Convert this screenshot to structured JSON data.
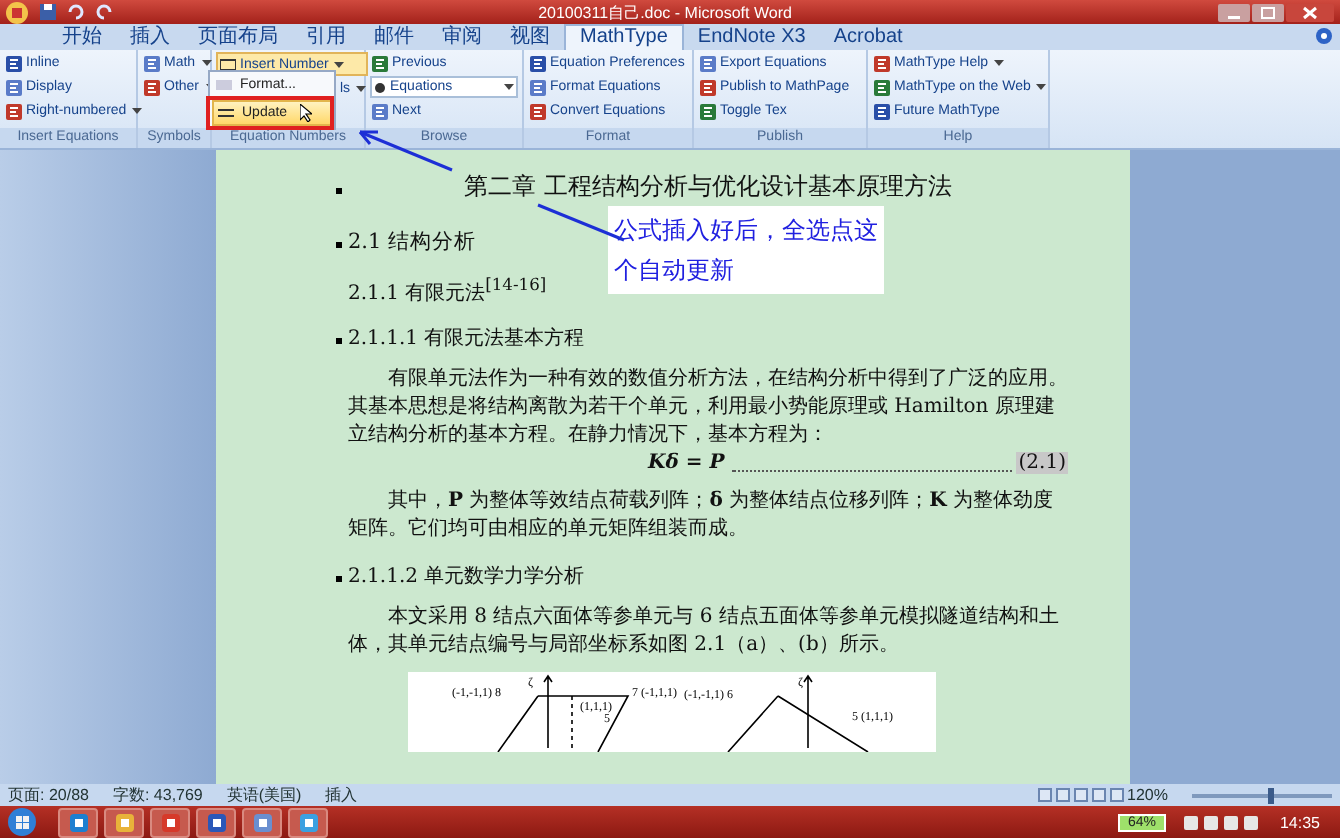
{
  "window": {
    "title": "20100311自己.doc - Microsoft Word"
  },
  "ribbon_tabs": [
    {
      "label": "开始",
      "selected": false
    },
    {
      "label": "插入",
      "selected": false
    },
    {
      "label": "页面布局",
      "selected": false
    },
    {
      "label": "引用",
      "selected": false
    },
    {
      "label": "邮件",
      "selected": false
    },
    {
      "label": "审阅",
      "selected": false
    },
    {
      "label": "视图",
      "selected": false
    },
    {
      "label": "MathType",
      "selected": true
    },
    {
      "label": "EndNote X3",
      "selected": false
    },
    {
      "label": "Acrobat",
      "selected": false
    }
  ],
  "ribbon_groups": [
    {
      "label": "Insert Equations",
      "items": [
        {
          "kind": "button",
          "label": "Inline",
          "caret": false
        },
        {
          "kind": "button",
          "label": "Display",
          "caret": false
        },
        {
          "kind": "button",
          "label": "Right-numbered",
          "caret": true
        }
      ]
    },
    {
      "label": "Symbols",
      "items": [
        {
          "kind": "button",
          "label": "Math",
          "caret": true
        },
        {
          "kind": "button",
          "label": "Other",
          "caret": true
        }
      ]
    },
    {
      "label": "Equation Numbers",
      "items": [
        {
          "kind": "open",
          "label": "Insert Number",
          "caret": true
        },
        {
          "kind": "hidden",
          "label": "ls",
          "caret": true
        }
      ]
    },
    {
      "label": "Browse",
      "items": [
        {
          "kind": "button",
          "label": "Previous",
          "caret": false
        },
        {
          "kind": "combo",
          "label": "Equations",
          "caret": true
        },
        {
          "kind": "button",
          "label": "Next",
          "caret": false
        }
      ]
    },
    {
      "label": "Format",
      "items": [
        {
          "kind": "button",
          "label": "Equation Preferences",
          "caret": false
        },
        {
          "kind": "button",
          "label": "Format Equations",
          "caret": false
        },
        {
          "kind": "button",
          "label": "Convert Equations",
          "caret": false
        }
      ]
    },
    {
      "label": "Publish",
      "items": [
        {
          "kind": "button",
          "label": "Export Equations",
          "caret": false
        },
        {
          "kind": "button",
          "label": "Publish to MathPage",
          "caret": false
        },
        {
          "kind": "button",
          "label": "Toggle Tex",
          "caret": false
        }
      ]
    },
    {
      "label": "Help",
      "items": [
        {
          "kind": "button",
          "label": "MathType Help",
          "caret": true
        },
        {
          "kind": "button",
          "label": "MathType on the Web",
          "caret": true
        },
        {
          "kind": "button",
          "label": "Future MathType",
          "caret": false
        }
      ]
    }
  ],
  "dropdown_menu": {
    "items": [
      {
        "label": "Format...",
        "selected": false
      },
      {
        "label": "Update",
        "selected": true
      }
    ]
  },
  "annotation": {
    "text": "公式插入好后，全选点这个自动更新"
  },
  "document": {
    "blocks": [
      {
        "kind": "chapter",
        "marked": true,
        "text": "第二章  工程结构分析与优化设计基本原理方法"
      },
      {
        "kind": "heading",
        "marked": true,
        "text": "2.1 结构分析"
      },
      {
        "kind": "subheading",
        "marked": false,
        "text": "2.1.1 有限元法$^{[14-16]}$"
      },
      {
        "kind": "subheading",
        "marked": true,
        "text": "2.1.1.1 有限元法基本方程"
      },
      {
        "kind": "para",
        "marked": false,
        "text": "有限单元法作为一种有效的数值分析方法，在结构分析中得到了广泛的应用。其基本思想是将结构离散为若干个单元，利用最小势能原理或 Hamilton 原理建立结构分析的基本方程。在静力情况下，基本方程为："
      },
      {
        "kind": "equation",
        "marked": false,
        "text": "Kδ = P",
        "number": "(2.1)"
      },
      {
        "kind": "para",
        "marked": false,
        "text": "其中，**P** 为整体等效结点荷载列阵；**δ** 为整体结点位移列阵；**K** 为整体劲度矩阵。它们均可由相应的单元矩阵组装而成。"
      },
      {
        "kind": "subheading",
        "marked": true,
        "text": "2.1.1.2 单元数学力学分析"
      },
      {
        "kind": "para",
        "marked": false,
        "text": "本文采用 8 结点六面体等参单元与 6 结点五面体等参单元模拟隧道结构和土体，其单元结点编号与局部坐标系如图 2.1（a）、(b）所示。"
      },
      {
        "kind": "figure",
        "marked": false,
        "labels": [
          "ζ",
          "(-1,-1,1) 8",
          "7 (-1,1,1)",
          "(1,1,1)",
          "5",
          "ζ",
          "(-1,-1,1) 6",
          "5 (1,1,1)"
        ]
      }
    ]
  },
  "status_bar": {
    "items": [
      "页面: 20/88",
      "字数: 43,769",
      "英语(美国)",
      "插入"
    ],
    "zoom": "120%",
    "level": 0.55
  },
  "taskbar": {
    "battery": "64%",
    "time": "14:35"
  }
}
